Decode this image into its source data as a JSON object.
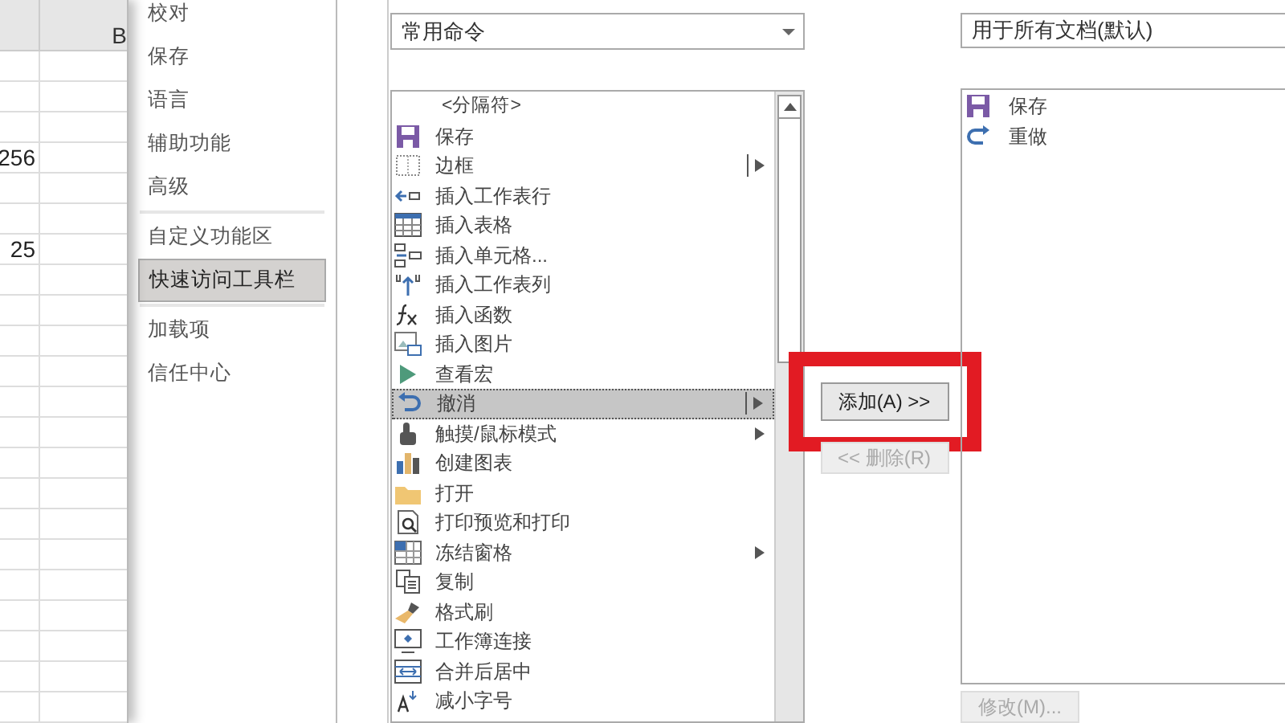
{
  "sheet": {
    "column_header": "B",
    "cells": [
      {
        "value": "256"
      },
      {
        "value": "25"
      }
    ]
  },
  "nav": {
    "items": [
      {
        "label": "校对",
        "selected": false,
        "separator_before": false
      },
      {
        "label": "保存",
        "selected": false,
        "separator_before": false
      },
      {
        "label": "语言",
        "selected": false,
        "separator_before": false
      },
      {
        "label": "辅助功能",
        "selected": false,
        "separator_before": false
      },
      {
        "label": "高级",
        "selected": false,
        "separator_before": false
      },
      {
        "label": "自定义功能区",
        "selected": false,
        "separator_before": true
      },
      {
        "label": "快速访问工具栏",
        "selected": true,
        "separator_before": false
      },
      {
        "label": "加载项",
        "selected": false,
        "separator_before": true
      },
      {
        "label": "信任中心",
        "selected": false,
        "separator_before": false
      }
    ]
  },
  "commands_dropdown": {
    "value": "常用命令"
  },
  "commands_list": [
    {
      "label": "<分隔符>",
      "kind": "separator",
      "submenu": false,
      "selected": false
    },
    {
      "label": "保存",
      "kind": "command",
      "submenu": false,
      "selected": false
    },
    {
      "label": "边框",
      "kind": "command",
      "submenu": true,
      "selected": false
    },
    {
      "label": "插入工作表行",
      "kind": "command",
      "submenu": false,
      "selected": false
    },
    {
      "label": "插入表格",
      "kind": "command",
      "submenu": false,
      "selected": false
    },
    {
      "label": "插入单元格...",
      "kind": "command",
      "submenu": false,
      "selected": false
    },
    {
      "label": "插入工作表列",
      "kind": "command",
      "submenu": false,
      "selected": false
    },
    {
      "label": "插入函数",
      "kind": "command",
      "submenu": false,
      "selected": false
    },
    {
      "label": "插入图片",
      "kind": "command",
      "submenu": false,
      "selected": false
    },
    {
      "label": "查看宏",
      "kind": "command",
      "submenu": false,
      "selected": false
    },
    {
      "label": "撤消",
      "kind": "command",
      "submenu": true,
      "selected": true
    },
    {
      "label": "触摸/鼠标模式",
      "kind": "command",
      "submenu": true,
      "selected": false
    },
    {
      "label": "创建图表",
      "kind": "command",
      "submenu": false,
      "selected": false
    },
    {
      "label": "打开",
      "kind": "command",
      "submenu": false,
      "selected": false
    },
    {
      "label": "打印预览和打印",
      "kind": "command",
      "submenu": false,
      "selected": false
    },
    {
      "label": "冻结窗格",
      "kind": "command",
      "submenu": true,
      "selected": false
    },
    {
      "label": "复制",
      "kind": "command",
      "submenu": false,
      "selected": false
    },
    {
      "label": "格式刷",
      "kind": "command",
      "submenu": false,
      "selected": false
    },
    {
      "label": "工作簿连接",
      "kind": "command",
      "submenu": false,
      "selected": false
    },
    {
      "label": "合并后居中",
      "kind": "command",
      "submenu": false,
      "selected": false
    },
    {
      "label": "减小字号",
      "kind": "command",
      "submenu": false,
      "selected": false
    }
  ],
  "add_button": {
    "label": "添加(A) >>",
    "disabled": false,
    "highlighted": true
  },
  "remove_button": {
    "label": "<< 删除(R)",
    "disabled": true
  },
  "scope_dropdown": {
    "value": "用于所有文档(默认)"
  },
  "toolbar_list": [
    {
      "label": "保存"
    },
    {
      "label": "重做"
    }
  ],
  "modify_button": {
    "label": "修改(M)...",
    "disabled": true
  }
}
